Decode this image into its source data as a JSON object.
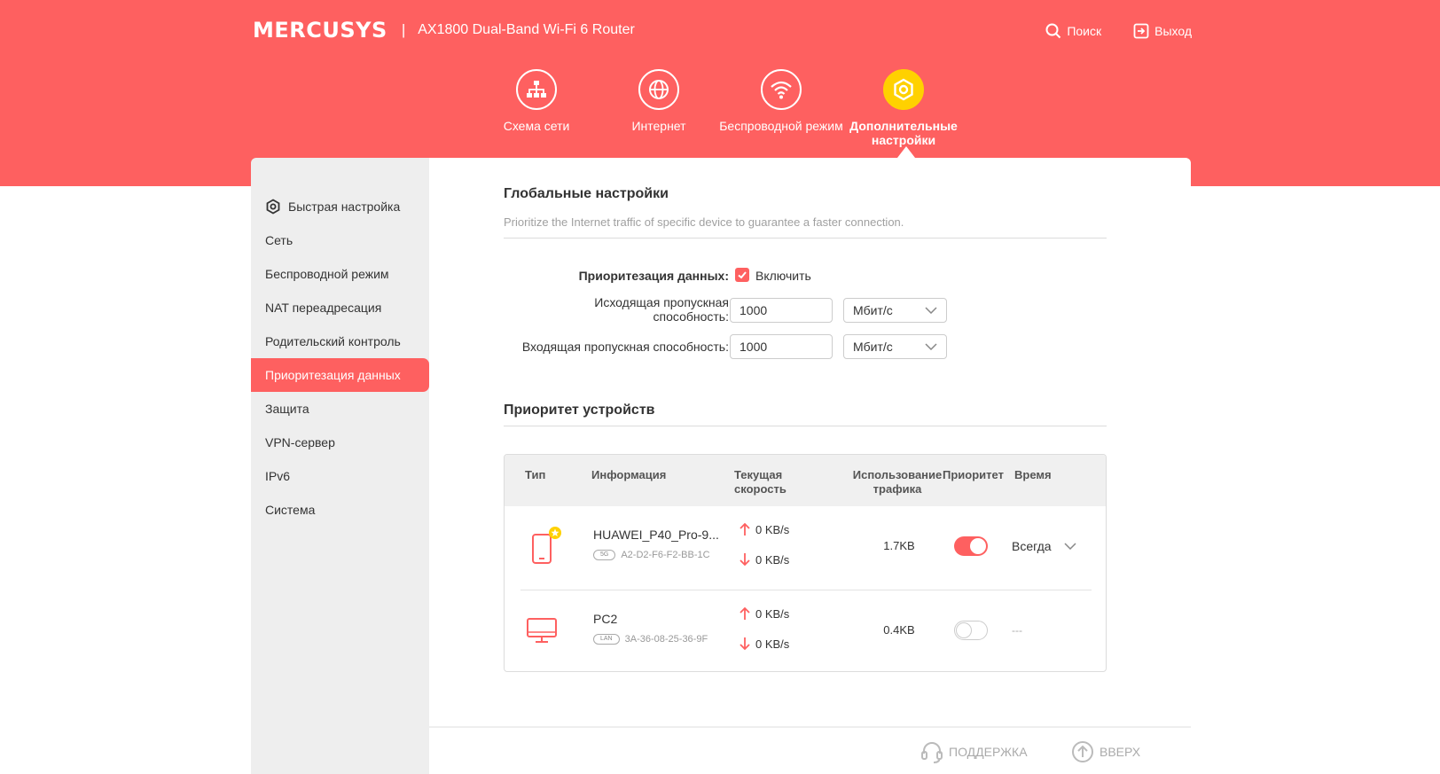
{
  "header": {
    "brand": "MERCUSYS",
    "separator": "|",
    "model": "AX1800 Dual-Band Wi-Fi 6 Router",
    "search_label": "Поиск",
    "logout_label": "Выход"
  },
  "nav": {
    "items": [
      {
        "label": "Схема сети",
        "icon": "network-map-icon"
      },
      {
        "label": "Интернет",
        "icon": "globe-icon"
      },
      {
        "label": "Беспроводной режим",
        "icon": "wifi-icon"
      },
      {
        "label": "Дополнительные настройки",
        "icon": "gear-icon",
        "active": true
      }
    ]
  },
  "sidebar": {
    "items": [
      {
        "label": "Быстрая настройка",
        "icon": "gear-icon"
      },
      {
        "label": "Сеть"
      },
      {
        "label": "Беспроводной режим"
      },
      {
        "label": "NAT переадресация"
      },
      {
        "label": "Родительский контроль"
      },
      {
        "label": "Приоритезация данных",
        "active": true
      },
      {
        "label": "Защита"
      },
      {
        "label": "VPN-сервер"
      },
      {
        "label": "IPv6"
      },
      {
        "label": "Система"
      }
    ]
  },
  "global": {
    "title": "Глобальные настройки",
    "description": "Prioritize the Internet traffic of specific device to guarantee a faster connection.",
    "qos_label": "Приоритезация данных:",
    "enable_label": "Включить",
    "enabled": true,
    "upload_label": "Исходящая пропускная способность:",
    "upload_value": "1000",
    "upload_unit": "Мбит/с",
    "download_label": "Входящая пропускная способность:",
    "download_value": "1000",
    "download_unit": "Мбит/с"
  },
  "devices": {
    "title": "Приоритет устройств",
    "columns": {
      "type": "Тип",
      "info": "Информация",
      "speed": "Текущая скорость",
      "traffic": "Использование трафика",
      "priority": "Приоритет",
      "time": "Время"
    },
    "rows": [
      {
        "name": "HUAWEI_P40_Pro-9...",
        "band": "5G",
        "mac": "A2-D2-F6-F2-BB-1C",
        "up": "0 KB/s",
        "down": "0 KB/s",
        "traffic": "1.7KB",
        "priority_on": true,
        "time": "Всегда",
        "icon": "phone-icon"
      },
      {
        "name": "PC2",
        "band": "LAN",
        "mac": "3A-36-08-25-36-9F",
        "up": "0 KB/s",
        "down": "0 KB/s",
        "traffic": "0.4KB",
        "priority_on": false,
        "time": "---",
        "icon": "monitor-icon"
      }
    ]
  },
  "footer": {
    "support_label": "ПОДДЕРЖКА",
    "top_label": "ВВЕРХ"
  },
  "colors": {
    "brand": "#fe6060",
    "active_icon": "#ffd100",
    "sidebar_bg": "#eeeeee"
  }
}
